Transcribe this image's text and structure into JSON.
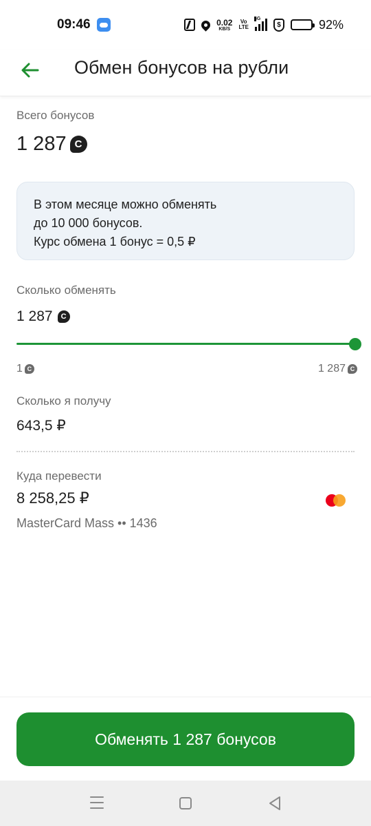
{
  "status_bar": {
    "time": "09:46",
    "speed_value": "0.02",
    "speed_unit": "KB/S",
    "volte_top": "Vo",
    "volte_bottom": "LTE",
    "network": "4G",
    "battery_percent": "92%",
    "battery_level": 0.92,
    "icons": [
      "weather-icon",
      "nfc-icon",
      "location-icon",
      "signal-icon",
      "shield-icon",
      "battery-icon"
    ]
  },
  "header": {
    "back_icon": "arrow-left-icon",
    "title": "Обмен бонусов на рубли"
  },
  "total": {
    "label": "Всего бонусов",
    "value": "1 287",
    "icon": "bonus-icon"
  },
  "info": {
    "line1": "В этом месяце можно обменять",
    "line2": "до 10 000 бонусов.",
    "line3": "Курс обмена 1 бонус = 0,5 ₽"
  },
  "exchange": {
    "label": "Сколько обменять",
    "value": "1 287",
    "slider_fraction": 1.0,
    "min": "1",
    "max": "1 287"
  },
  "receive": {
    "label": "Сколько я получу",
    "value": "643,5 ₽"
  },
  "destination": {
    "label": "Куда перевести",
    "balance": "8 258,25 ₽",
    "card_name": "MasterCard Mass •• 1436",
    "card_icon": "mastercard-icon"
  },
  "action": {
    "button_label": "Обменять 1 287 бонусов"
  },
  "colors": {
    "accent": "#1e8f30",
    "info_background": "#eef3f8",
    "secondary_text": "#6b6b6b"
  },
  "nav": {
    "icons": [
      "menu-icon",
      "home-icon",
      "back-icon"
    ]
  }
}
